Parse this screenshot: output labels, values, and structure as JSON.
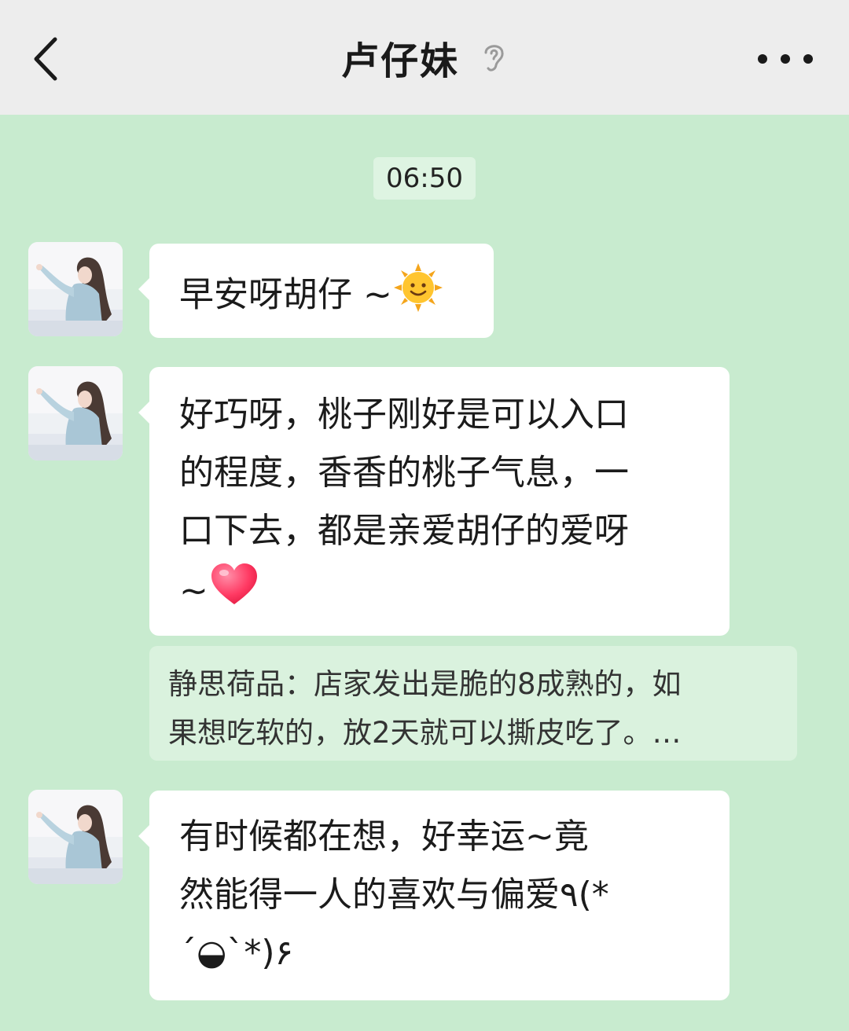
{
  "header": {
    "title": "卢仔妹"
  },
  "timestamp": "06:50",
  "messages": [
    {
      "text": "早安呀胡仔 ~",
      "emoji": "sun-with-face"
    },
    {
      "lines": [
        "好巧呀，桃子刚好是可以入口",
        "的程度，香香的桃子气息，一",
        "口下去，都是亲爱胡仔的爱呀",
        "~"
      ],
      "emoji": "red-heart"
    },
    {
      "lines": [
        "有时候都在想，好幸运~竟",
        "然能得一人的喜欢与偏爱٩(*",
        "´◒`*)۶"
      ]
    }
  ],
  "quote": {
    "lines": [
      "静思荷品：店家发出是脆的8成熟的，如",
      "果想吃软的，放2天就可以撕皮吃了。…"
    ]
  },
  "icons": {
    "back": "chevron-left-icon",
    "ear": "ear-icon",
    "more": "more-dots-icon"
  },
  "colors": {
    "chat_background": "#c8ebcf",
    "topbar_background": "#ededed",
    "bubble_background": "#ffffff",
    "quote_background": "#daf2de"
  }
}
